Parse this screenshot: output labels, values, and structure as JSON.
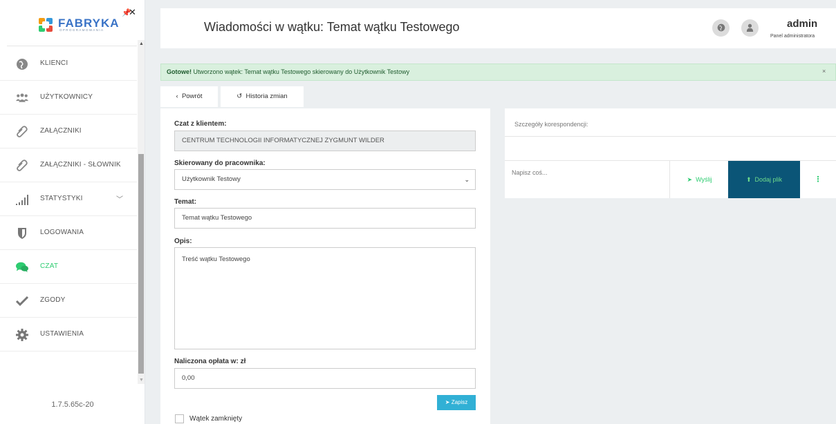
{
  "app": {
    "logo_text": "FABRYKA",
    "logo_sub": "OPROGRAMOWANIA",
    "version": "1.7.5.65c-20"
  },
  "sidebar": {
    "items": [
      {
        "label": "KLIENCI",
        "icon": "globe-icon"
      },
      {
        "label": "UŻYTKOWNICY",
        "icon": "users-icon"
      },
      {
        "label": "ZAŁĄCZNIKI",
        "icon": "paperclip-icon"
      },
      {
        "label": "ZAŁĄCZNIKI - SŁOWNIK",
        "icon": "paperclip-icon"
      },
      {
        "label": "STATYSTYKI",
        "icon": "signal-bars-icon"
      },
      {
        "label": "LOGOWANIA",
        "icon": "shield-icon"
      },
      {
        "label": "CZAT",
        "icon": "chat-icon",
        "active": true
      },
      {
        "label": "ZGODY",
        "icon": "check-icon"
      },
      {
        "label": "USTAWIENIA",
        "icon": "gear-icon"
      }
    ]
  },
  "header": {
    "title": "Wiadomości w wątku: Temat wątku Testowego",
    "user_name": "admin",
    "user_role": "Panel administratora"
  },
  "alert": {
    "strong": "Gotowe!",
    "text": " Utworzono wątek: Temat wątku Testowego skierowany do Użytkownik Testowy",
    "close": "×"
  },
  "toolbar": {
    "back_label": "Powrót",
    "history_label": "Historia zmian"
  },
  "form": {
    "client_label": "Czat z klientem:",
    "client_value": "CENTRUM TECHNOLOGII INFORMATYCZNEJ ZYGMUNT WILDER",
    "employee_label": "Skierowany do pracownika:",
    "employee_value": "Użytkownik Testowy",
    "subject_label": "Temat:",
    "subject_value": "Temat wątku Testowego",
    "description_label": "Opis:",
    "description_value": "Treść wątku Testowego",
    "fee_label": "Naliczona opłata w: zł",
    "fee_value": "0,00",
    "save_label": "Zapisz",
    "closed_label": "Wątek zamknięty"
  },
  "correspondence": {
    "title": "Szczegóły korespondencji:",
    "placeholder": "Napisz coś...",
    "send_label": "Wyślij",
    "add_file_label": "Dodaj plik"
  },
  "colors": {
    "accent_green": "#2ecc71",
    "dark_teal": "#0b5577",
    "info_blue": "#31b0d5",
    "alert_bg": "#d9f0de"
  }
}
